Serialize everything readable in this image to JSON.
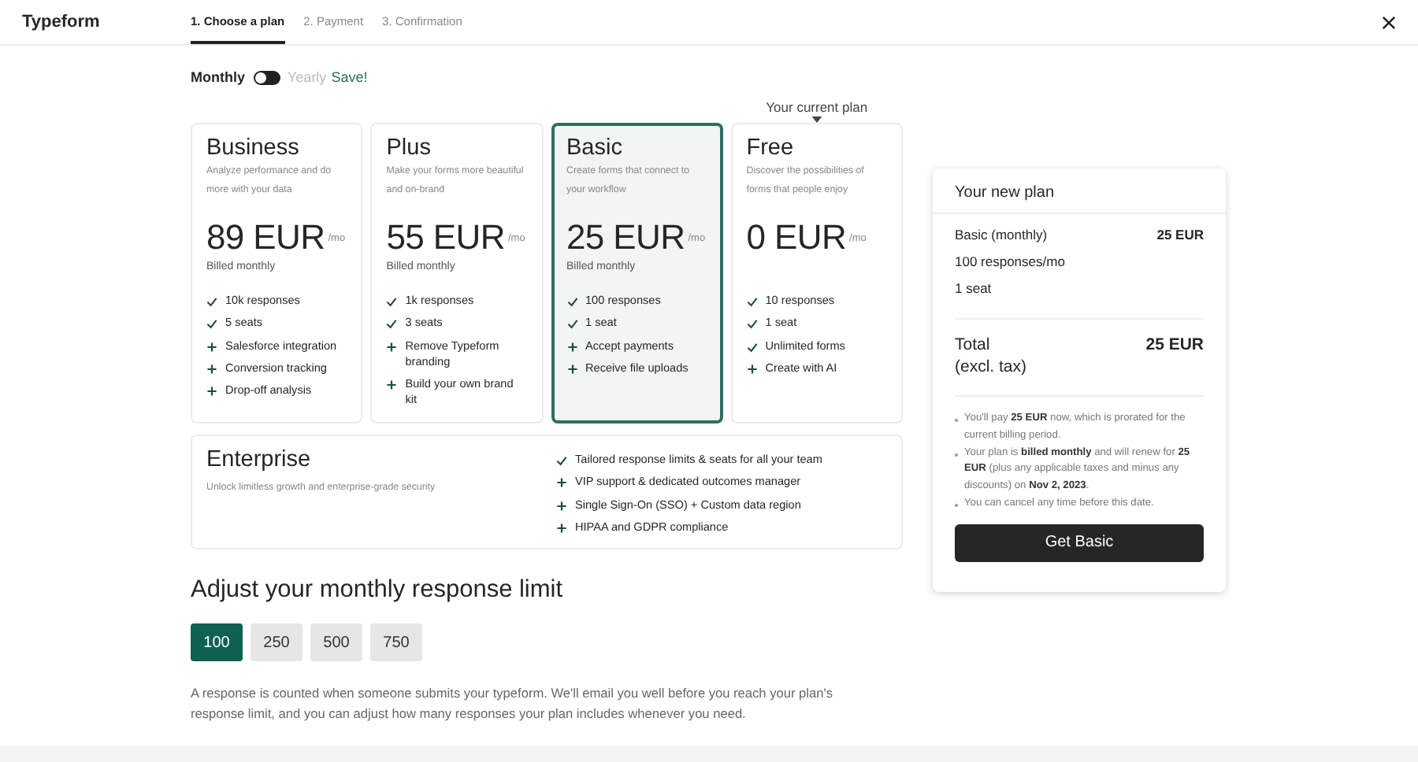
{
  "header": {
    "logo": "Typeform",
    "steps": [
      {
        "label": "1. Choose a plan",
        "selected": true
      },
      {
        "label": "2. Payment",
        "selected": false
      },
      {
        "label": "3. Confirmation",
        "selected": false
      }
    ]
  },
  "billing": {
    "monthly": "Monthly",
    "yearly": "Yearly",
    "save": "Save!",
    "on": false
  },
  "current_plan_label": "Your current plan",
  "plans": [
    {
      "name": "Business",
      "description": "Analyze performance and do more with your data",
      "price": "89 EUR",
      "unit": "/mo",
      "billing": "Billed monthly",
      "selected": false,
      "current": false,
      "features": [
        {
          "kind": "check",
          "text": "10k responses"
        },
        {
          "kind": "check",
          "text": "5 seats"
        },
        {
          "kind": "plus",
          "text": "Salesforce integration"
        },
        {
          "kind": "plus",
          "text": "Conversion tracking"
        },
        {
          "kind": "plus",
          "text": "Drop-off analysis"
        }
      ]
    },
    {
      "name": "Plus",
      "description": "Make your forms more beautiful and on-brand",
      "price": "55 EUR",
      "unit": "/mo",
      "billing": "Billed monthly",
      "selected": false,
      "current": false,
      "features": [
        {
          "kind": "check",
          "text": "1k responses"
        },
        {
          "kind": "check",
          "text": "3 seats"
        },
        {
          "kind": "plus",
          "text": "Remove Typeform branding"
        },
        {
          "kind": "plus",
          "text": "Build your own brand kit"
        }
      ]
    },
    {
      "name": "Basic",
      "description": "Create forms that connect to your workflow",
      "price": "25 EUR",
      "unit": "/mo",
      "billing": "Billed monthly",
      "selected": true,
      "current": false,
      "features": [
        {
          "kind": "check",
          "text": "100 responses"
        },
        {
          "kind": "check",
          "text": "1 seat"
        },
        {
          "kind": "plus",
          "text": "Accept payments"
        },
        {
          "kind": "plus",
          "text": "Receive file uploads"
        }
      ]
    },
    {
      "name": "Free",
      "description": "Discover the possibilities of forms that people enjoy",
      "price": "0 EUR",
      "unit": "/mo",
      "selected": false,
      "current": true,
      "features": [
        {
          "kind": "check",
          "text": "10 responses"
        },
        {
          "kind": "check",
          "text": "1 seat"
        },
        {
          "kind": "check",
          "text": "Unlimited forms"
        },
        {
          "kind": "plus",
          "text": "Create with AI"
        }
      ]
    }
  ],
  "enterprise": {
    "name": "Enterprise",
    "description": "Unlock limitless growth and enterprise-grade security",
    "features": [
      {
        "kind": "check",
        "text": "Tailored response limits & seats for all your team"
      },
      {
        "kind": "plus",
        "text": "VIP support & dedicated outcomes manager"
      },
      {
        "kind": "plus",
        "text": "Single Sign-On (SSO) + Custom data region"
      },
      {
        "kind": "plus",
        "text": "HIPAA and GDPR compliance"
      }
    ]
  },
  "limit": {
    "title": "Adjust your monthly response limit",
    "options": [
      {
        "label": "100",
        "selected": true
      },
      {
        "label": "250",
        "selected": false
      },
      {
        "label": "500",
        "selected": false
      },
      {
        "label": "750",
        "selected": false
      }
    ],
    "note": "A response is counted when someone submits your typeform. We'll email you well before you reach your plan's response limit, and you can adjust how many responses your plan includes whenever you need."
  },
  "summary": {
    "title": "Your new plan",
    "plan": "Basic (monthly)",
    "plan_price": "25 EUR",
    "lines": [
      "100 responses/mo",
      "1 seat"
    ],
    "total": "Total",
    "total_note": "(excl. tax)",
    "total_price": "25 EUR",
    "notes": [
      "You'll pay **25 EUR** now, which is prorated for the current billing period.",
      "Your plan is **billed monthly** and will renew for **25 EUR** (plus any applicable taxes and minus any discounts) on **Nov 2, 2023**.",
      "You can cancel any time before this date."
    ],
    "button": "Get Basic"
  }
}
